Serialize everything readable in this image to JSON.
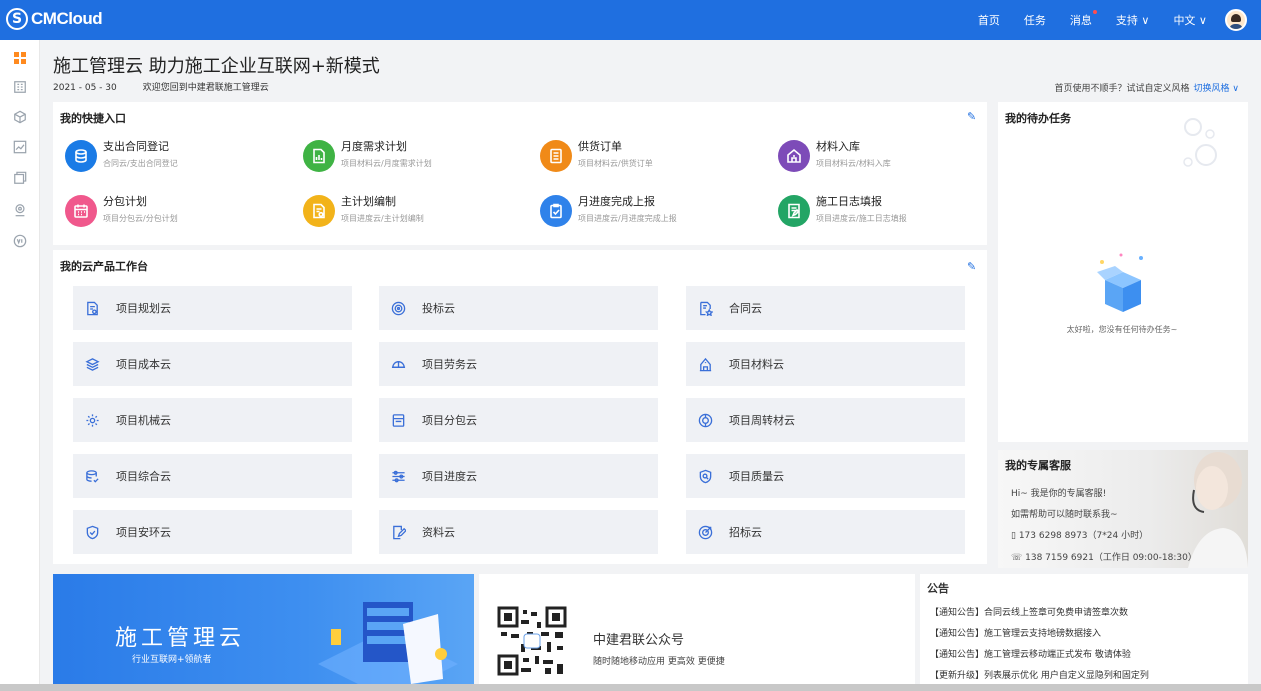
{
  "header": {
    "logo_mark": "S",
    "logo_text": "CMCloud",
    "nav": [
      "首页",
      "任务",
      "消息",
      "支持 ∨",
      "中文 ∨"
    ]
  },
  "page": {
    "title": "施工管理云 助力施工企业互联网+新模式",
    "date": "2021 - 05 - 30",
    "welcome": "欢迎您回到中建君联施工管理云",
    "hint": "首页使用不顺手？试试自定义风格",
    "hint_link": "切换风格 ∨"
  },
  "quick": {
    "title": "我的快捷入口",
    "items": [
      {
        "title": "支出合同登记",
        "sub": "合同云/支出合同登记",
        "color": "#1a7be6",
        "icon": "database-icon"
      },
      {
        "title": "月度需求计划",
        "sub": "项目材料云/月度需求计划",
        "color": "#3fb344",
        "icon": "document-chart-icon"
      },
      {
        "title": "供货订单",
        "sub": "项目材料云/供货订单",
        "color": "#f08a18",
        "icon": "list-doc-icon"
      },
      {
        "title": "材料入库",
        "sub": "项目材料云/材料入库",
        "color": "#7d4bb8",
        "icon": "warehouse-icon"
      },
      {
        "title": "分包计划",
        "sub": "项目分包云/分包计划",
        "color": "#f0588c",
        "icon": "calendar-icon"
      },
      {
        "title": "主计划编制",
        "sub": "项目进度云/主计划编制",
        "color": "#f2b31a",
        "icon": "plan-doc-icon"
      },
      {
        "title": "月进度完成上报",
        "sub": "项目进度云/月进度完成上报",
        "color": "#2f82ea",
        "icon": "clipboard-check-icon"
      },
      {
        "title": "施工日志填报",
        "sub": "项目进度云/施工日志填报",
        "color": "#23a565",
        "icon": "log-doc-icon"
      }
    ]
  },
  "workbench": {
    "title": "我的云产品工作台",
    "items": [
      {
        "label": "项目规划云",
        "icon": "plan-doc-icon"
      },
      {
        "label": "投标云",
        "icon": "target-icon"
      },
      {
        "label": "合同云",
        "icon": "contract-star-icon"
      },
      {
        "label": "项目成本云",
        "icon": "layers-icon"
      },
      {
        "label": "项目劳务云",
        "icon": "helmet-icon"
      },
      {
        "label": "项目材料云",
        "icon": "building-icon"
      },
      {
        "label": "项目机械云",
        "icon": "gear-icon"
      },
      {
        "label": "项目分包云",
        "icon": "package-icon"
      },
      {
        "label": "项目周转材云",
        "icon": "cycle-icon"
      },
      {
        "label": "项目综合云",
        "icon": "database-check-icon"
      },
      {
        "label": "项目进度云",
        "icon": "sliders-icon"
      },
      {
        "label": "项目质量云",
        "icon": "shield-search-icon"
      },
      {
        "label": "项目安环云",
        "icon": "shield-check-icon"
      },
      {
        "label": "资料云",
        "icon": "file-edit-icon"
      },
      {
        "label": "招标云",
        "icon": "target-arrow-icon"
      }
    ]
  },
  "todo": {
    "title": "我的待办任务",
    "empty": "太好啦，您没有任何待办任务~"
  },
  "service": {
    "title": "我的专属客服",
    "line1": "Hi~ 我是你的专属客服!",
    "line2": "如需帮助可以随时联系我~",
    "phone1": "173 6298 8973（7*24 小时）",
    "phone2": "138 7159 6921（工作日 09:00-18:30）"
  },
  "banners": {
    "b1_title": "施工管理云",
    "b1_sub": "行业互联网+领航者",
    "b2_title": "中建君联公众号",
    "b2_sub": "随时随地移动应用 更高效 更便捷"
  },
  "notice": {
    "title": "公告",
    "items": [
      "【通知公告】合同云线上签章可免费申请签章次数",
      "【通知公告】施工管理云支持地磅数据接入",
      "【通知公告】施工管理云移动端正式发布 敬请体验",
      "【更新升级】列表展示优化 用户自定义显隐列和固定列"
    ]
  },
  "colors": {
    "primary": "#1f6fe0",
    "accent_orange": "#ff8a1f"
  }
}
